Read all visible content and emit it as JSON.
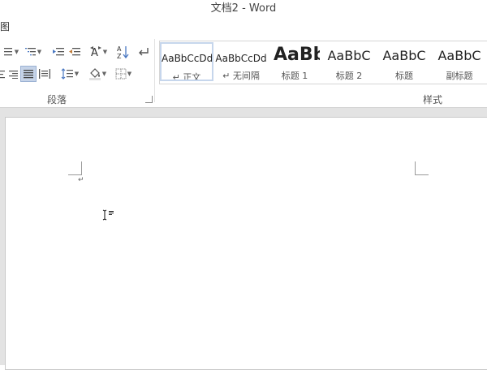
{
  "window": {
    "title": "文档2 - Word"
  },
  "tabs": {
    "visible_fragment": "图"
  },
  "ribbon": {
    "paragraph_group": {
      "label": "段落",
      "sort_symbol": "A↓Z"
    },
    "styles_group": {
      "label": "样式",
      "items": [
        {
          "sample": "AaBbCcDd",
          "name": "↵ 正文",
          "selected": true
        },
        {
          "sample": "AaBbCcDd",
          "name": "↵ 无间隔",
          "selected": false
        },
        {
          "sample": "AaBb",
          "name": "标题 1",
          "selected": false
        },
        {
          "sample": "AaBbC",
          "name": "标题 2",
          "selected": false
        },
        {
          "sample": "AaBbC",
          "name": "标题",
          "selected": false
        },
        {
          "sample": "AaBbC",
          "name": "副标题",
          "selected": false
        }
      ]
    }
  },
  "document": {
    "paragraph_mark": "↵"
  }
}
